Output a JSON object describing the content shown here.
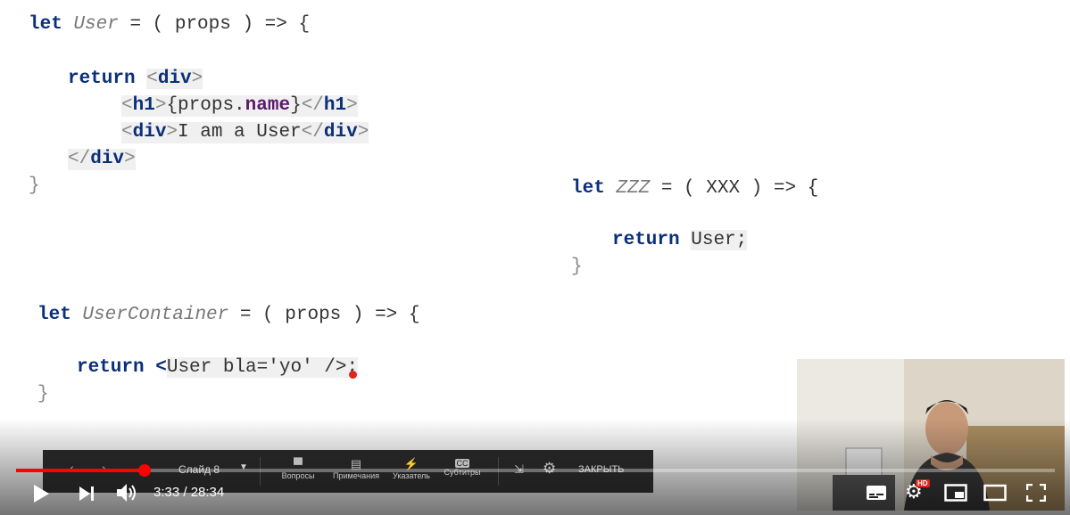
{
  "code": {
    "user_kw": "let",
    "user_name": "User",
    "user_sig": " = ( props ) => {",
    "user_return": "return",
    "user_open_div": "div",
    "user_h1": "h1",
    "user_props": "{props.",
    "user_name_prop": "name",
    "user_props_close": "}",
    "user_div_text": "I am a User",
    "user_close": "}",
    "zzz_kw": "let",
    "zzz_name": "ZZZ",
    "zzz_sig": " = ( XXX ) => {",
    "zzz_return": "return",
    "zzz_value": "User;",
    "zzz_close": "}",
    "uc_kw": "let",
    "uc_name": "UserContainer",
    "uc_sig": " = ( props ) => {",
    "uc_return": "return",
    "uc_tag_open": "<",
    "uc_jsx": "User bla='yo' />;",
    "uc_close": "}"
  },
  "slides_panel": {
    "slide_label": "Слайд 8",
    "items": [
      "Вопросы",
      "Примечания",
      "Указатель",
      "Субтитры"
    ],
    "close_label": "ЗАКРЫТЬ"
  },
  "player": {
    "time": "3:33 / 28:34",
    "progress_fraction": 0.124,
    "hd_badge": "HD"
  },
  "colors": {
    "progress": "#ff0000",
    "keyword": "#0b2f7a"
  }
}
